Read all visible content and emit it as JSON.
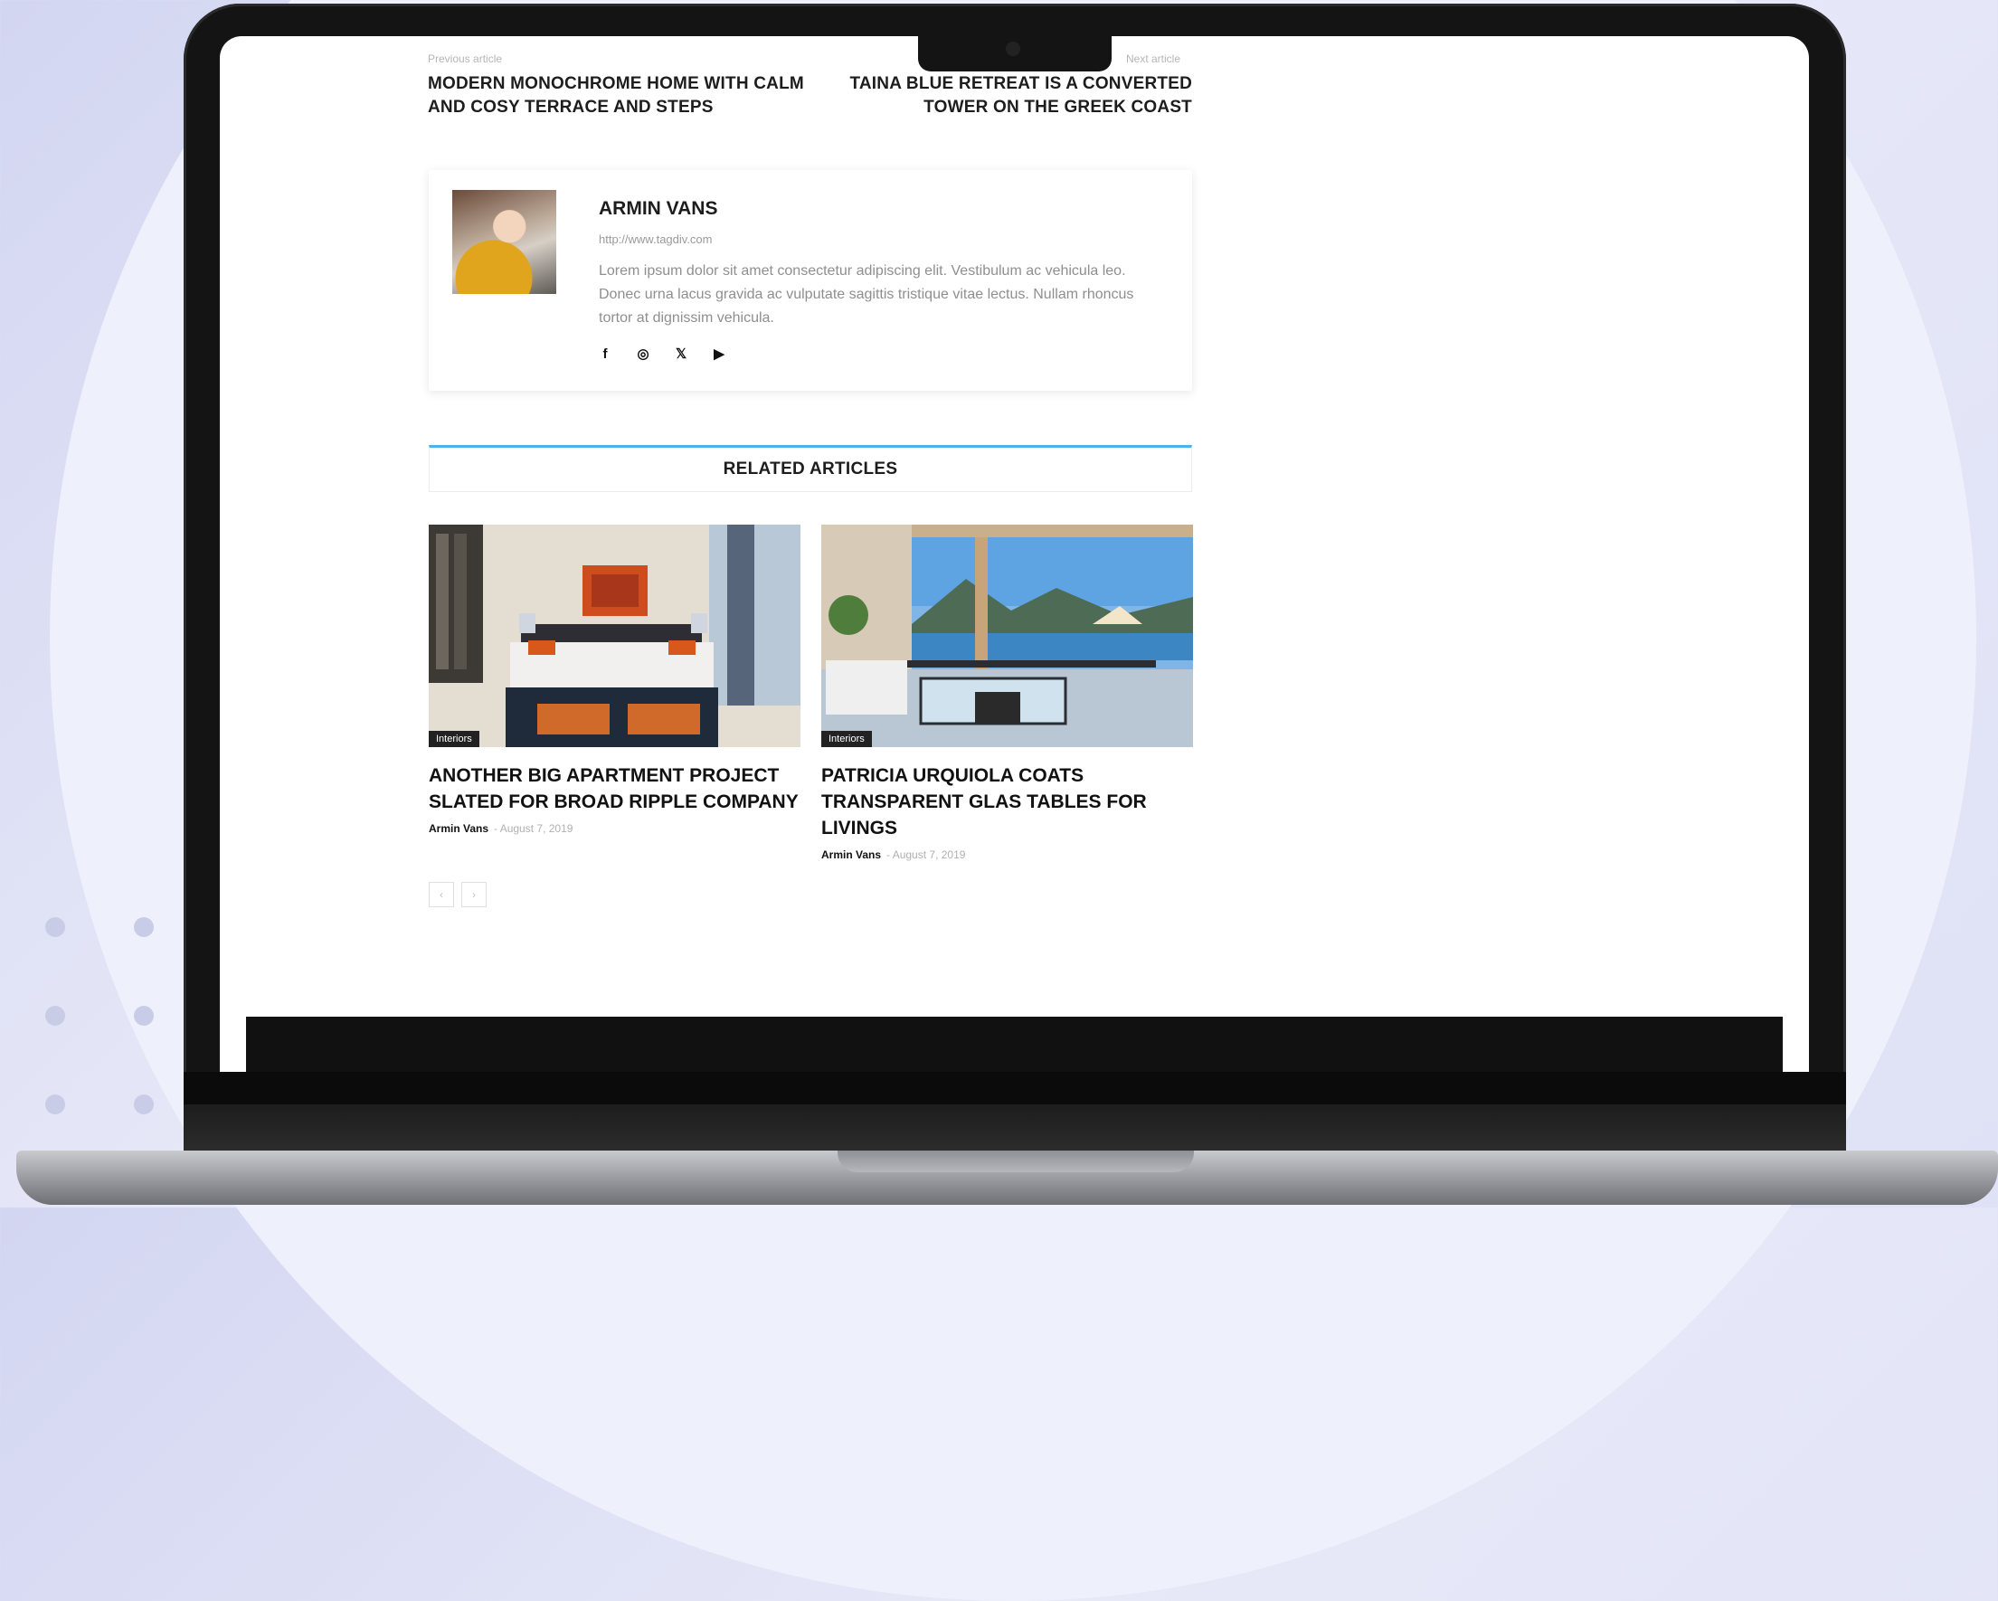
{
  "previous_article": {
    "label": "Previous article",
    "title": "MODERN MONOCHROME HOME WITH CALM AND COSY TERRACE AND STEPS"
  },
  "next_article": {
    "label": "Next article",
    "title": "TAINA BLUE RETREAT IS A CONVERTED TOWER ON THE GREEK COAST"
  },
  "author": {
    "name": "ARMIN VANS",
    "url": "http://www.tagdiv.com",
    "bio": "Lorem ipsum dolor sit amet consectetur adipiscing elit. Vestibulum ac vehicula leo. Donec urna lacus gravida ac vulputate sagittis tristique vitae lectus. Nullam rhoncus tortor at dignissim vehicula.",
    "socials": [
      {
        "icon": "facebook-icon",
        "glyph": "f"
      },
      {
        "icon": "instagram-icon",
        "glyph": "◎"
      },
      {
        "icon": "x-twitter-icon",
        "glyph": "𝕏"
      },
      {
        "icon": "youtube-icon",
        "glyph": "▶"
      }
    ]
  },
  "related": {
    "heading": "RELATED ARTICLES",
    "articles": [
      {
        "category": "Interiors",
        "title": "ANOTHER BIG APARTMENT PROJECT SLATED FOR BROAD RIPPLE COMPANY",
        "author": "Armin Vans",
        "date": "August 7, 2019"
      },
      {
        "category": "Interiors",
        "title": "PATRICIA URQUIOLA COATS TRANSPARENT GLAS TABLES FOR LIVINGS",
        "author": "Armin Vans",
        "date": "August 7, 2019"
      }
    ],
    "pager": {
      "prev": "‹",
      "next": "›"
    }
  },
  "colors": {
    "accent": "#4db2ec",
    "page_bg": "#ffffff",
    "laptop_frame": "#141414"
  }
}
